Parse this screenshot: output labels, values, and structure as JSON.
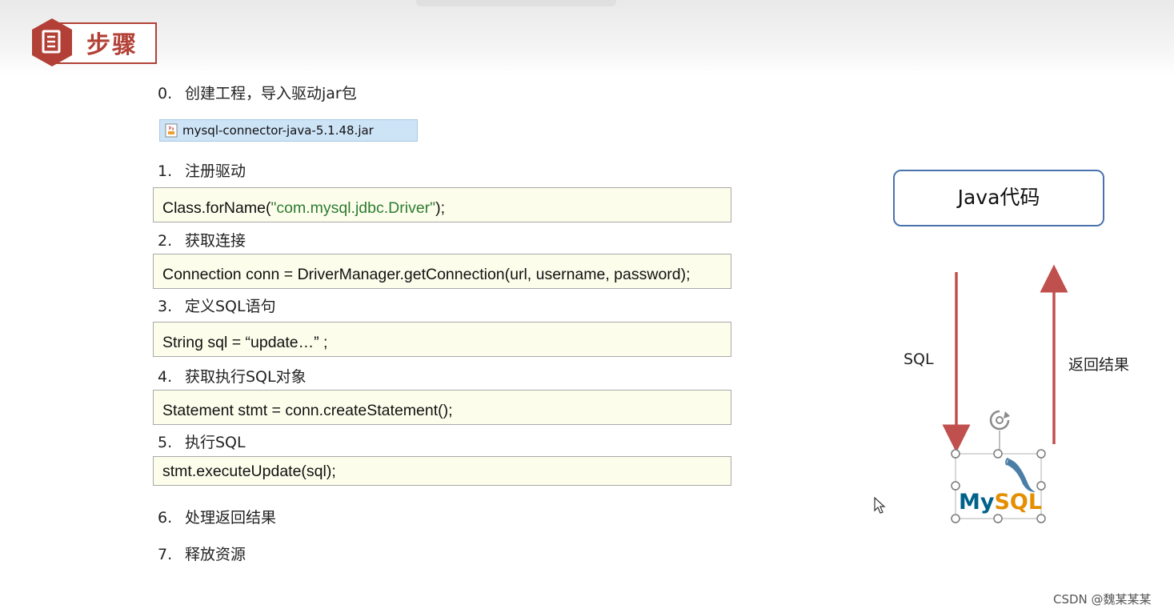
{
  "header": {
    "title": "步骤"
  },
  "steps": {
    "s0": {
      "num": "0.",
      "label": "创建工程，导入驱动jar包"
    },
    "s1": {
      "num": "1.",
      "label": "注册驱动"
    },
    "s2": {
      "num": "2.",
      "label": "获取连接"
    },
    "s3": {
      "num": "3.",
      "label": "定义SQL语句"
    },
    "s4": {
      "num": "4.",
      "label": "获取执行SQL对象"
    },
    "s5": {
      "num": "5.",
      "label": "执行SQL"
    },
    "s6": {
      "num": "6.",
      "label": "处理返回结果"
    },
    "s7": {
      "num": "7.",
      "label": "释放资源"
    }
  },
  "jar_file": {
    "name": "mysql-connector-java-5.1.48.jar",
    "icon": "jar-file-icon"
  },
  "code": {
    "c1_prefix": "Class.forName(",
    "c1_string": "\"com.mysql.jdbc.Driver\"",
    "c1_suffix": ");",
    "c2": "Connection conn = DriverManager.getConnection(url, username, password);",
    "c3": "String sql =  “update…” ;",
    "c4": "Statement stmt = conn.createStatement();",
    "c5": "stmt.executeUpdate(sql);"
  },
  "diagram": {
    "java_box": "Java代码",
    "sql_label": "SQL",
    "result_label": "返回结果",
    "mysql_logo_text": "MySQL",
    "arrow_color": "#c0504d",
    "box_border_color": "#4a73ad"
  },
  "colors": {
    "accent": "#b24036",
    "code_bg": "#fdfdec",
    "string_green": "#2e7d32"
  },
  "watermark": "CSDN @魏某某某"
}
